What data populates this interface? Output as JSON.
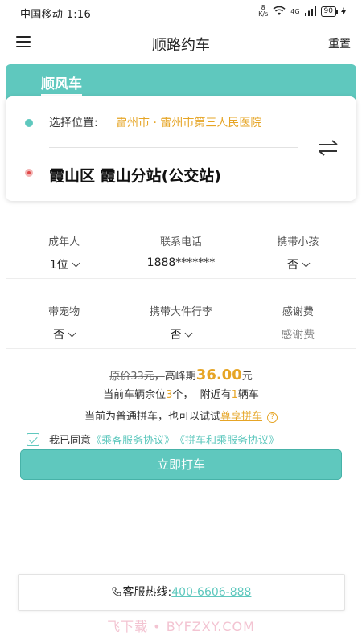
{
  "status_bar": {
    "carrier_time": "中国移动 1:16",
    "net_speed_value": "8",
    "net_speed_unit": "K/s",
    "network": "4G",
    "battery": "90"
  },
  "nav": {
    "title": "顺路约车",
    "reset_label": "重置"
  },
  "tab": {
    "label": "顺风车"
  },
  "location": {
    "start_label": "选择位置:",
    "start_value": "雷州市 · 雷州市第三人民医院",
    "end_value": "霞山区 霞山分站(公交站)"
  },
  "options_row1": {
    "adults_label": "成年人",
    "adults_value": "1位",
    "phone_label": "联系电话",
    "phone_value": "1888*******",
    "children_label": "携带小孩",
    "children_value": "否"
  },
  "options_row2": {
    "pets_label": "带宠物",
    "pets_value": "否",
    "luggage_label": "携带大件行李",
    "luggage_value": "否",
    "tip_label": "感谢费",
    "tip_placeholder": "感谢费"
  },
  "price": {
    "original": "原价33元，",
    "peak_label": "高峰期",
    "peak_value": "36.00",
    "unit": "元"
  },
  "seats": {
    "prefix": "当前车辆余位",
    "seats_count": "3",
    "middle": "个，  附近有",
    "cars_count": "1",
    "suffix": "辆车"
  },
  "carpool": {
    "text": "当前为普通拼车，也可以试试",
    "link": "尊享拼车",
    "help_symbol": "?"
  },
  "agreement": {
    "text": "我已同意",
    "link1": "《乘客服务协议》",
    "link2": "《拼车和乘服务协议》"
  },
  "book_button_label": "立即打车",
  "hotline": {
    "label": "客服热线:",
    "number": "400-6606-888"
  },
  "watermark": "飞下载 • BYFZXY.COM",
  "colors": {
    "accent": "#5fc8be",
    "highlight": "#e6a526"
  }
}
